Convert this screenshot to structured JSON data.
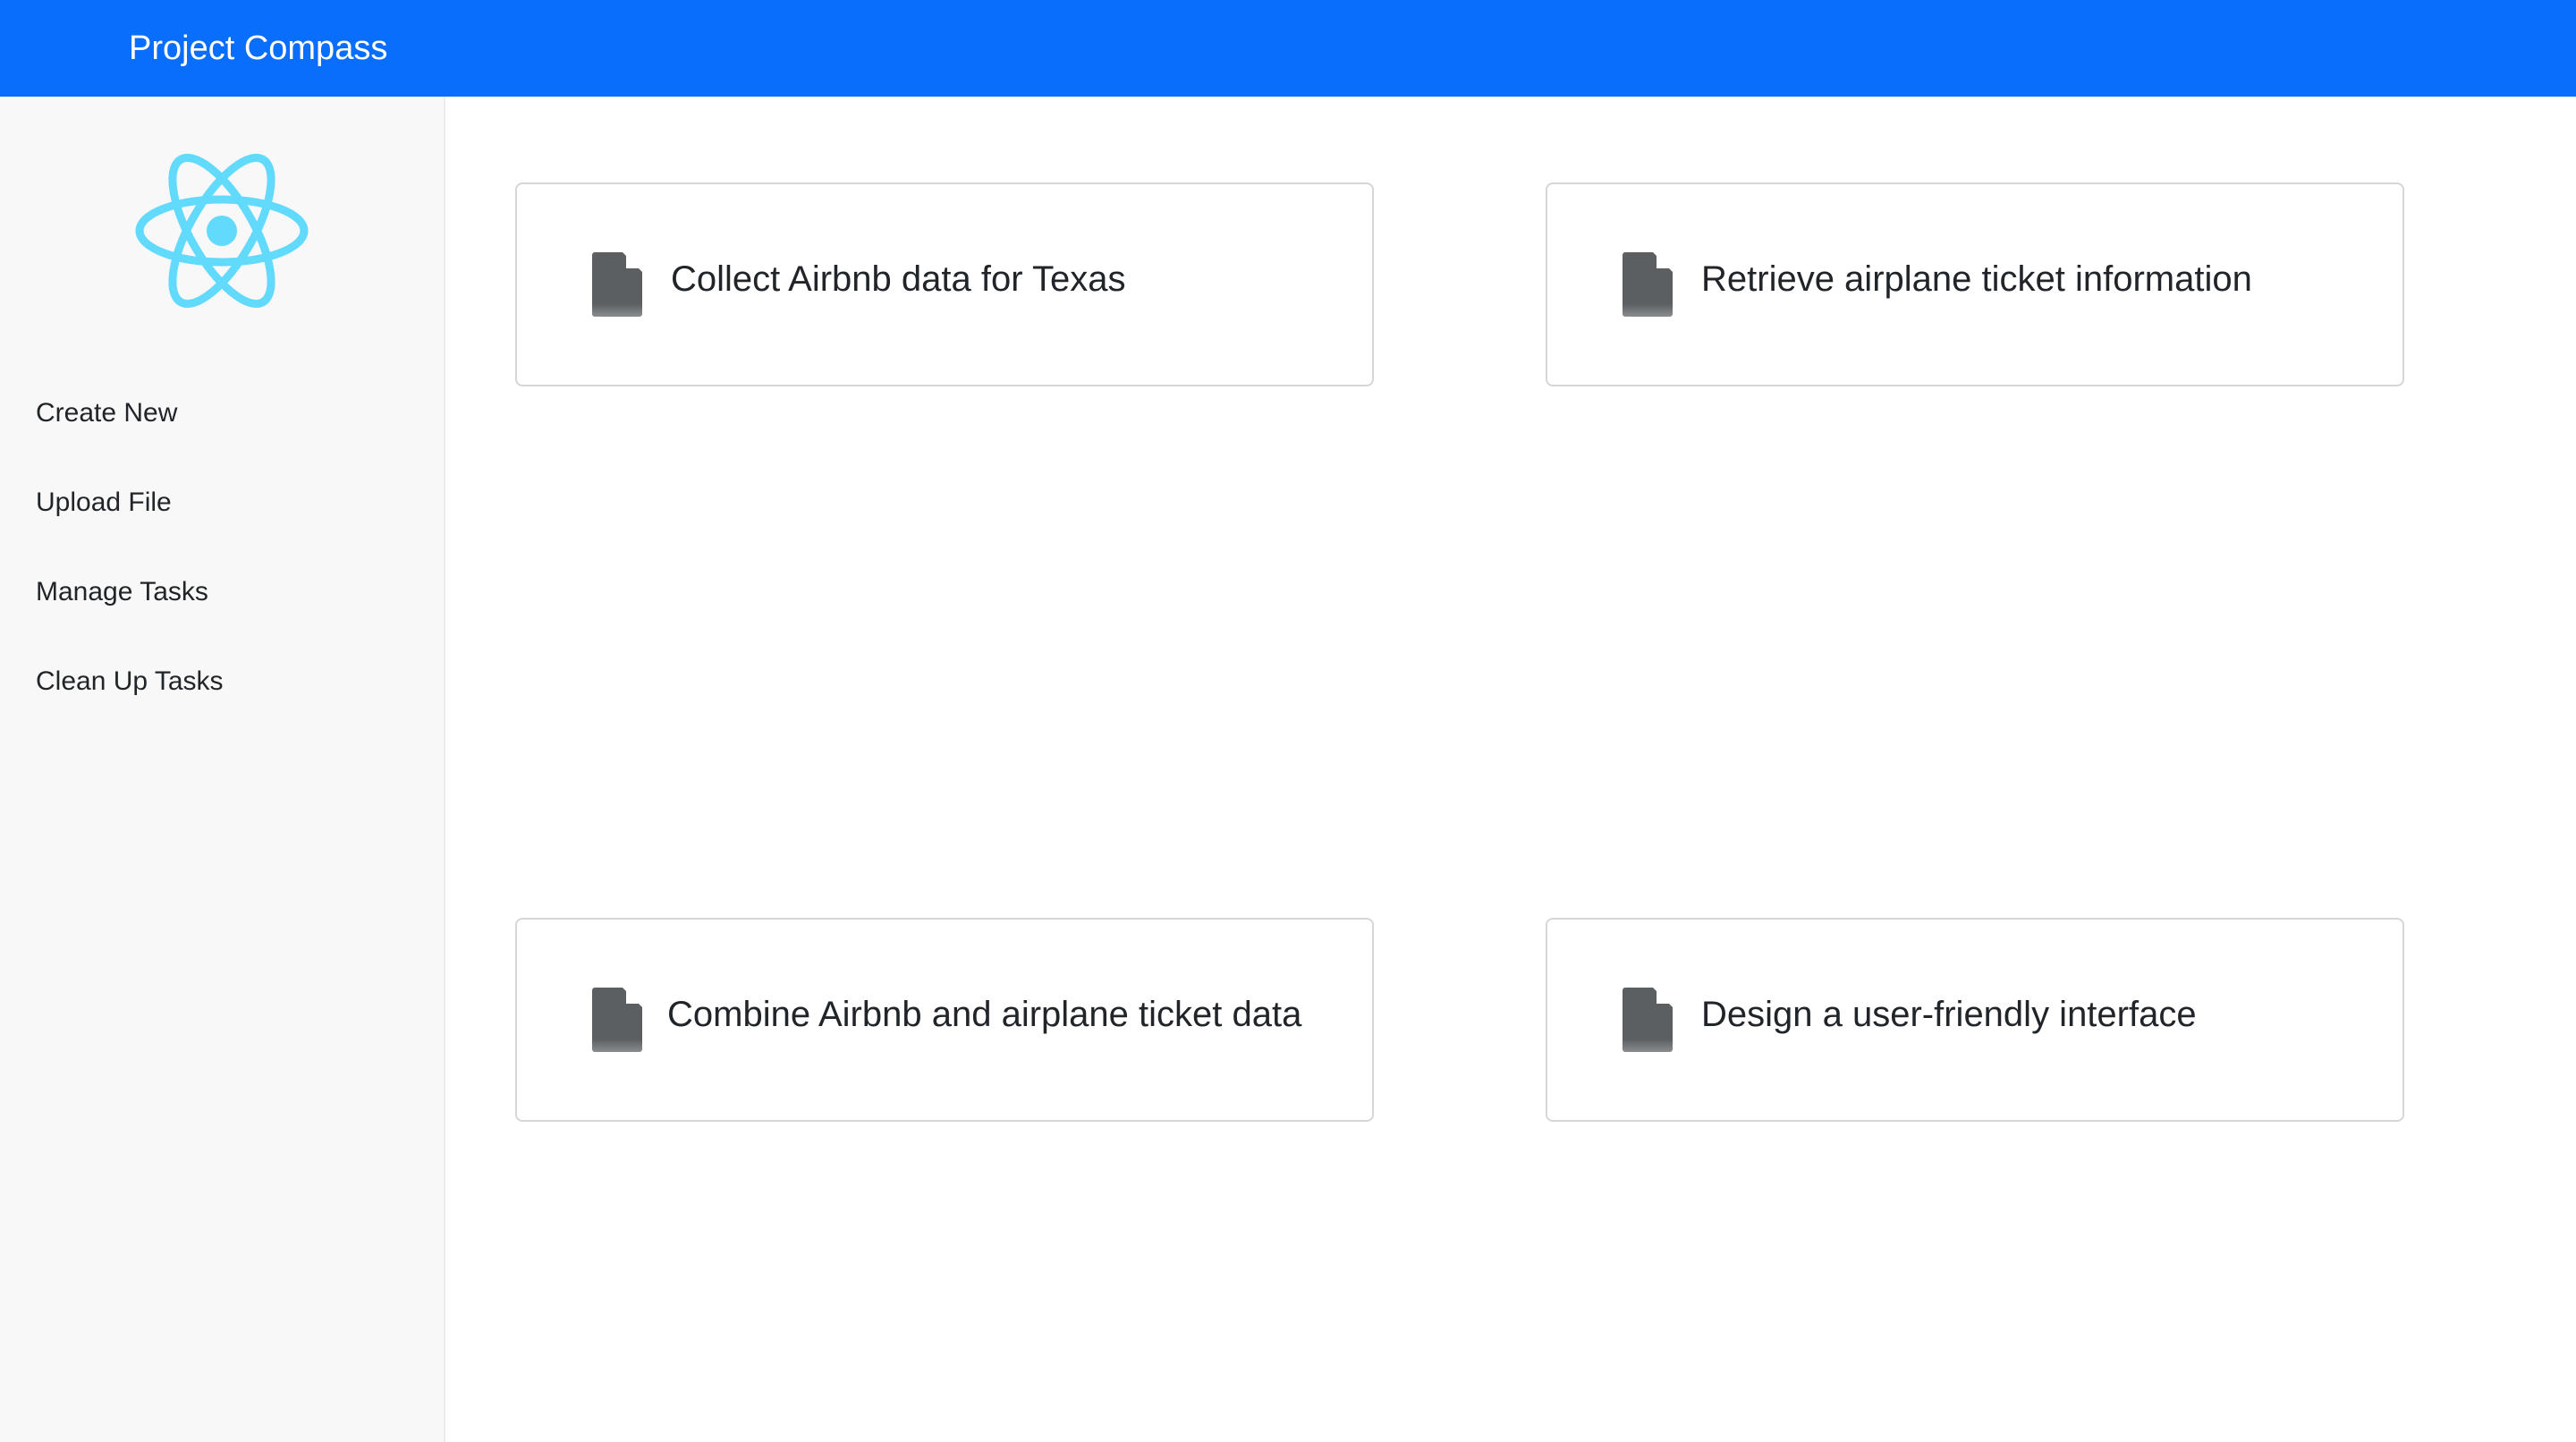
{
  "header": {
    "title": "Project Compass",
    "background_color": "#0a6efd"
  },
  "sidebar": {
    "logo_icon": "react-atom-icon",
    "logo_color": "#61dafb",
    "items": [
      {
        "label": "Create New"
      },
      {
        "label": "Upload File"
      },
      {
        "label": "Manage Tasks"
      },
      {
        "label": "Clean Up Tasks"
      }
    ]
  },
  "main": {
    "cards": [
      {
        "label": "Collect Airbnb data for Texas",
        "icon": "document-icon"
      },
      {
        "label": "Retrieve airplane ticket information",
        "icon": "document-icon"
      },
      {
        "label": "Combine Airbnb and airplane ticket data",
        "icon": "document-icon"
      },
      {
        "label": "Design a user-friendly interface",
        "icon": "document-icon"
      }
    ]
  }
}
